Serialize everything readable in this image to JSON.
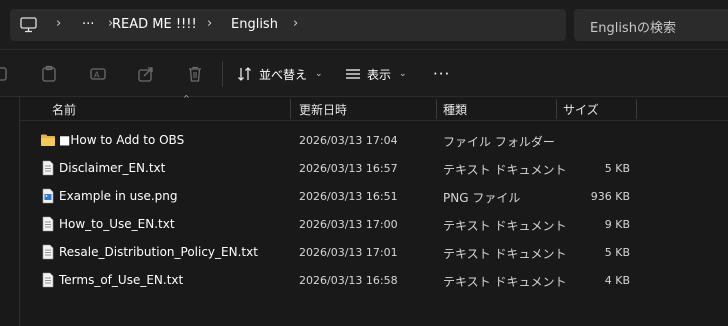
{
  "address_bar": {
    "more_label": "···",
    "breadcrumbs": [
      "READ ME !!!!",
      "English"
    ]
  },
  "search": {
    "placeholder": "Englishの検索"
  },
  "toolbar": {
    "sort_label": "並べ替え",
    "view_label": "表示",
    "more_label": "···"
  },
  "columns": {
    "name": "名前",
    "date": "更新日時",
    "type": "種類",
    "size": "サイズ"
  },
  "files": [
    {
      "icon": "folder-icon",
      "name": "■How to Add to OBS",
      "date": "2026/03/13 17:04",
      "type": "ファイル フォルダー",
      "size": ""
    },
    {
      "icon": "text-file-icon",
      "name": "Disclaimer_EN.txt",
      "date": "2026/03/13 16:57",
      "type": "テキスト ドキュメント",
      "size": "5 KB"
    },
    {
      "icon": "image-file-icon",
      "name": "Example in use.png",
      "date": "2026/03/13 16:51",
      "type": "PNG ファイル",
      "size": "936 KB"
    },
    {
      "icon": "text-file-icon",
      "name": "How_to_Use_EN.txt",
      "date": "2026/03/13 17:00",
      "type": "テキスト ドキュメント",
      "size": "9 KB"
    },
    {
      "icon": "text-file-icon",
      "name": "Resale_Distribution_Policy_EN.txt",
      "date": "2026/03/13 17:01",
      "type": "テキスト ドキュメント",
      "size": "5 KB"
    },
    {
      "icon": "text-file-icon",
      "name": "Terms_of_Use_EN.txt",
      "date": "2026/03/13 16:58",
      "type": "テキスト ドキュメント",
      "size": "4 KB"
    }
  ],
  "colors": {
    "background": "#191919",
    "folder": "#e8b33a",
    "image_accent": "#2f7ad6"
  }
}
